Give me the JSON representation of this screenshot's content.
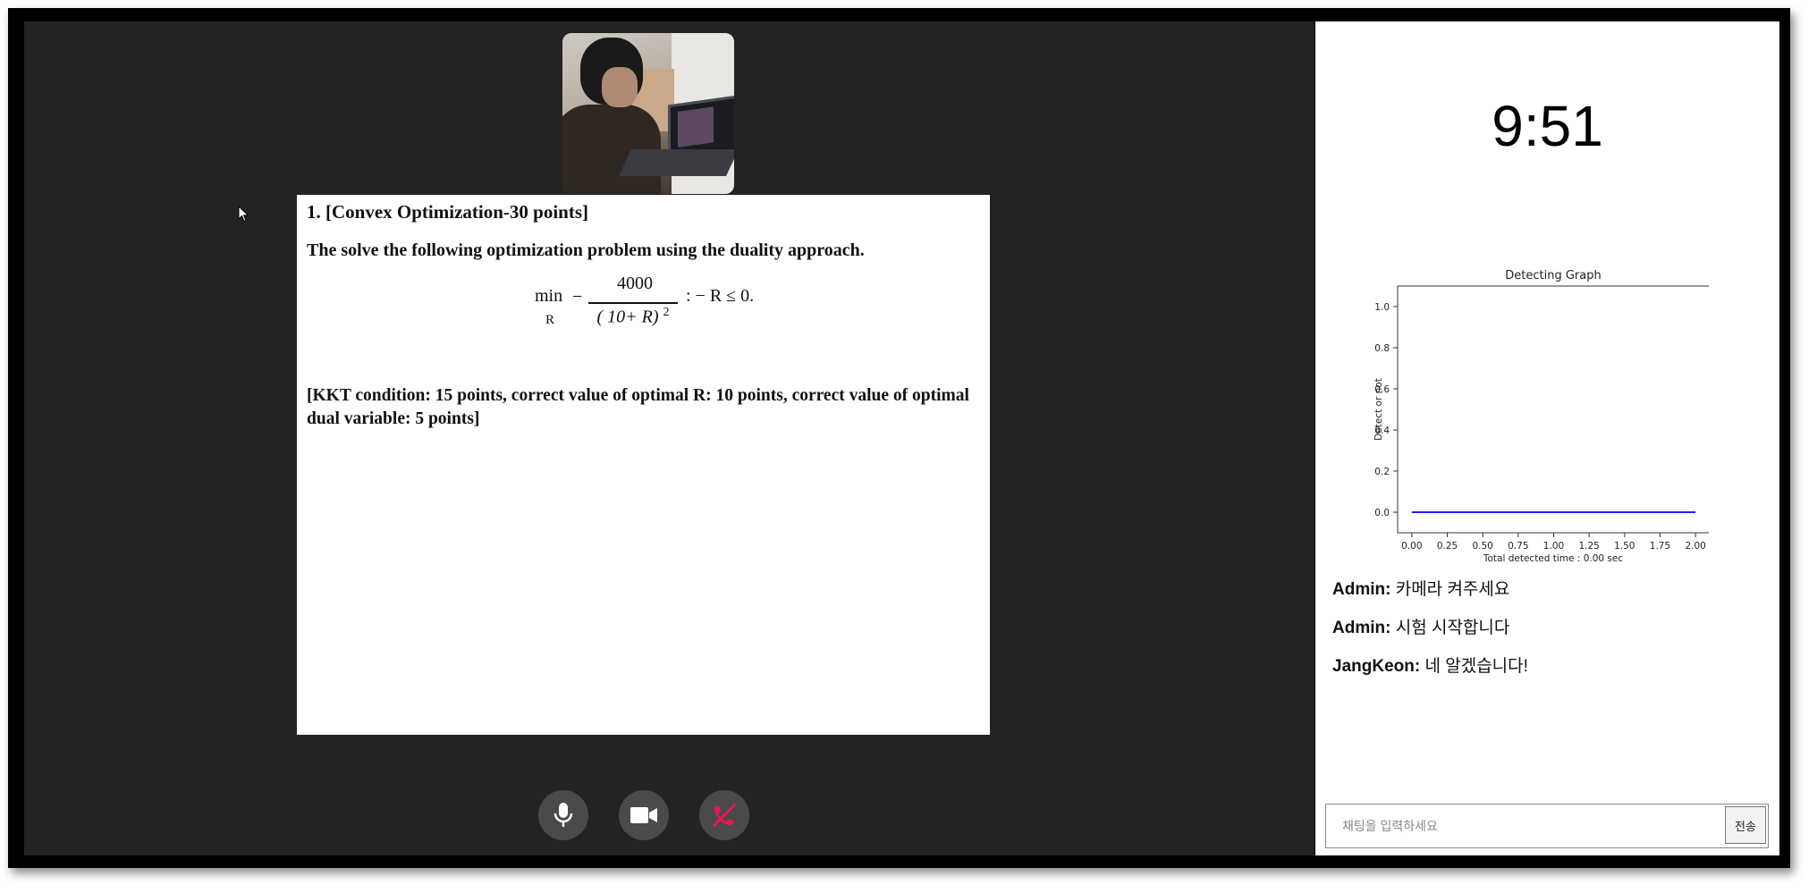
{
  "question": {
    "title": "1. [Convex Optimization-30 points]",
    "statement": "The solve the following optimization problem using the duality approach.",
    "equation": {
      "min": "min",
      "sub": "R",
      "minus": "−",
      "numerator": "4000",
      "denominator": "( 10+ R)",
      "exponent": "2",
      "constraint": ": − R ≤ 0."
    },
    "kkt": "[KKT condition: 15 points, correct value of optimal R: 10 points, correct value of optimal dual variable: 5 points]"
  },
  "controls": {
    "mic_icon": "microphone-icon",
    "camera_icon": "video-camera-icon",
    "end_icon": "hang-up-icon",
    "end_color": "#e8194f"
  },
  "timer": "9:51",
  "chart_data": {
    "type": "line",
    "title": "Detecting Graph",
    "xlabel": "Total detected time : 0.00 sec",
    "ylabel": "Detect or not",
    "x_ticks": [
      "0.00",
      "0.25",
      "0.50",
      "0.75",
      "1.00",
      "1.25",
      "1.50",
      "1.75",
      "2.00"
    ],
    "y_ticks": [
      "0.0",
      "0.2",
      "0.4",
      "0.6",
      "0.8",
      "1.0"
    ],
    "xlim": [
      -0.1,
      2.1
    ],
    "ylim": [
      -0.1,
      1.1
    ],
    "series": [
      {
        "x": [
          0.0,
          2.0
        ],
        "values": [
          0.0,
          0.0
        ],
        "color": "#1f1fff"
      }
    ],
    "grid": false
  },
  "chat": {
    "messages": [
      {
        "sender": "Admin:",
        "text": "카메라 켜주세요"
      },
      {
        "sender": "Admin:",
        "text": "시험 시작합니다"
      },
      {
        "sender": "JangKeon:",
        "text": "네 알겠습니다!"
      }
    ],
    "input_placeholder": "채팅을 입력하세요",
    "send_label": "전송"
  }
}
